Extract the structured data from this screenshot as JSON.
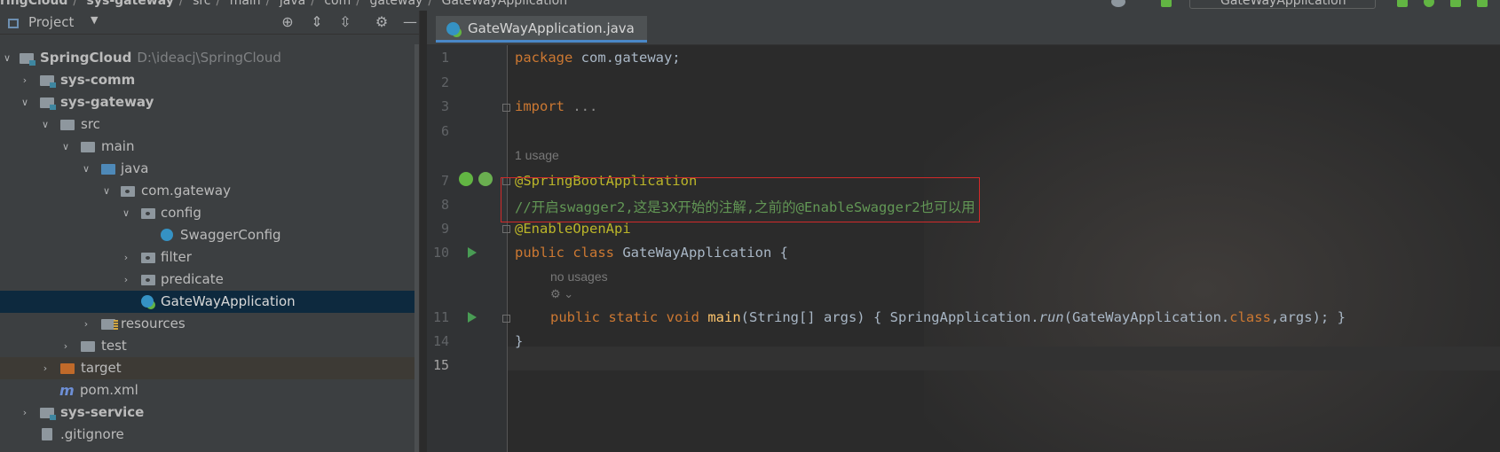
{
  "breadcrumb": {
    "items": [
      "ringCloud",
      "sys-gateway",
      "src",
      "main",
      "java",
      "com",
      "gateway",
      "GateWayApplication"
    ],
    "separator": "/"
  },
  "toolbar": {
    "run_config": "GateWayApplication"
  },
  "project_panel": {
    "title": "Project",
    "tree": [
      {
        "label": "SpringCloud",
        "path": "D:\\ideacj\\SpringCloud"
      },
      {
        "label": "sys-comm"
      },
      {
        "label": "sys-gateway"
      },
      {
        "label": "src"
      },
      {
        "label": "main"
      },
      {
        "label": "java"
      },
      {
        "label": "com.gateway"
      },
      {
        "label": "config"
      },
      {
        "label": "SwaggerConfig"
      },
      {
        "label": "filter"
      },
      {
        "label": "predicate"
      },
      {
        "label": "GateWayApplication"
      },
      {
        "label": "resources"
      },
      {
        "label": "test"
      },
      {
        "label": "target"
      },
      {
        "label": "pom.xml",
        "icon": "m"
      },
      {
        "label": "sys-service"
      },
      {
        "label": ".gitignore"
      }
    ]
  },
  "editor": {
    "tab_label": "GateWayApplication.java",
    "line_numbers": [
      "1",
      "2",
      "3",
      "6",
      "7",
      "8",
      "9",
      "10",
      "11",
      "14",
      "15"
    ],
    "lines": {
      "l1_kw": "package",
      "l1_rest": " com.gateway;",
      "l3_kw": "import",
      "l3_rest": " ...",
      "usage_hint": "1 usage",
      "l7": "@SpringBootApplication",
      "l8": "//开启swagger2,这是3X开始的注解,之前的@EnableSwagger2也可以用",
      "l9": "@EnableOpenApi",
      "l10_kw": "public class",
      "l10_name": " GateWayApplication {",
      "no_usages_hint": "no usages",
      "l11_kw": "public static void",
      "l11_fn": "main",
      "l11_a": "(String[] args) { SpringApplication.",
      "l11_run": "run",
      "l11_b": "(GateWayApplication.",
      "l11_class": "class",
      "l11_c": ",args); }",
      "l14": "}"
    }
  },
  "colors": {
    "keyword": "#cc7832",
    "annotation": "#bbb529",
    "comment": "#629755",
    "method": "#ffc66d",
    "highlight_box": "#d12a2a",
    "selection": "#0d293e"
  }
}
